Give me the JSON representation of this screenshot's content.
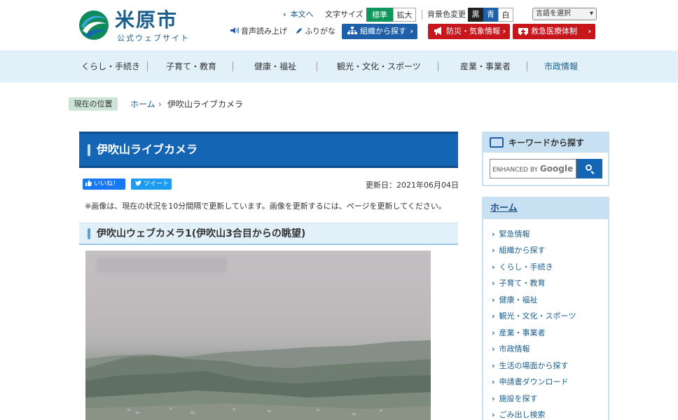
{
  "header": {
    "logo_title": "米原市",
    "logo_sub": "公式ウェブサイト",
    "skip_link": "本文へ",
    "font_size_label": "文字サイズ",
    "font_size_std": "標準",
    "font_size_large": "拡大",
    "bg_color_label": "背景色変更",
    "bg_black": "黒",
    "bg_blue": "青",
    "bg_white": "白",
    "language_select": "言語を選択",
    "voice_read": "音声読み上げ",
    "furigana": "ふりがな",
    "org_search": "組織から探す",
    "disaster_info": "防災・気象情報",
    "emergency_medical": "救急医療体制"
  },
  "gnav": {
    "items": [
      "くらし・手続き",
      "子育て・教育",
      "健康・福祉",
      "観光・文化・スポーツ",
      "産業・事業者",
      "市政情報"
    ]
  },
  "breadcrumb": {
    "label": "現在の位置",
    "home": "ホーム",
    "arrow": "›",
    "current": "伊吹山ライブカメラ"
  },
  "main": {
    "title": "伊吹山ライブカメラ",
    "like_button": "いいね！",
    "tweet_button": "ツイート",
    "updated": "更新日：2021年06月04日",
    "note": "※画像は、現在の状況を10分間隔で更新しています。画像を更新するには、ページを更新してください。",
    "camera_heading": "伊吹山ウェブカメラ1(伊吹山3合目からの眺望)"
  },
  "sidebar": {
    "keyword_title": "キーワードから探す",
    "search_prefix": "ENHANCED BY",
    "search_brand": "Google",
    "home_title": "ホーム",
    "home_items": [
      "緊急情報",
      "組織から探す",
      "くらし・手続き",
      "子育て・教育",
      "健康・福祉",
      "観光・文化・スポーツ",
      "産業・事業者",
      "市政情報",
      "生活の場面から探す",
      "申請書ダウンロード",
      "施設を探す",
      "ごみ出し検索"
    ]
  },
  "colors": {
    "brand_blue": "#1466b5",
    "green": "#10965c",
    "red": "#c8161d",
    "nav_bg": "#e2f0f9"
  }
}
